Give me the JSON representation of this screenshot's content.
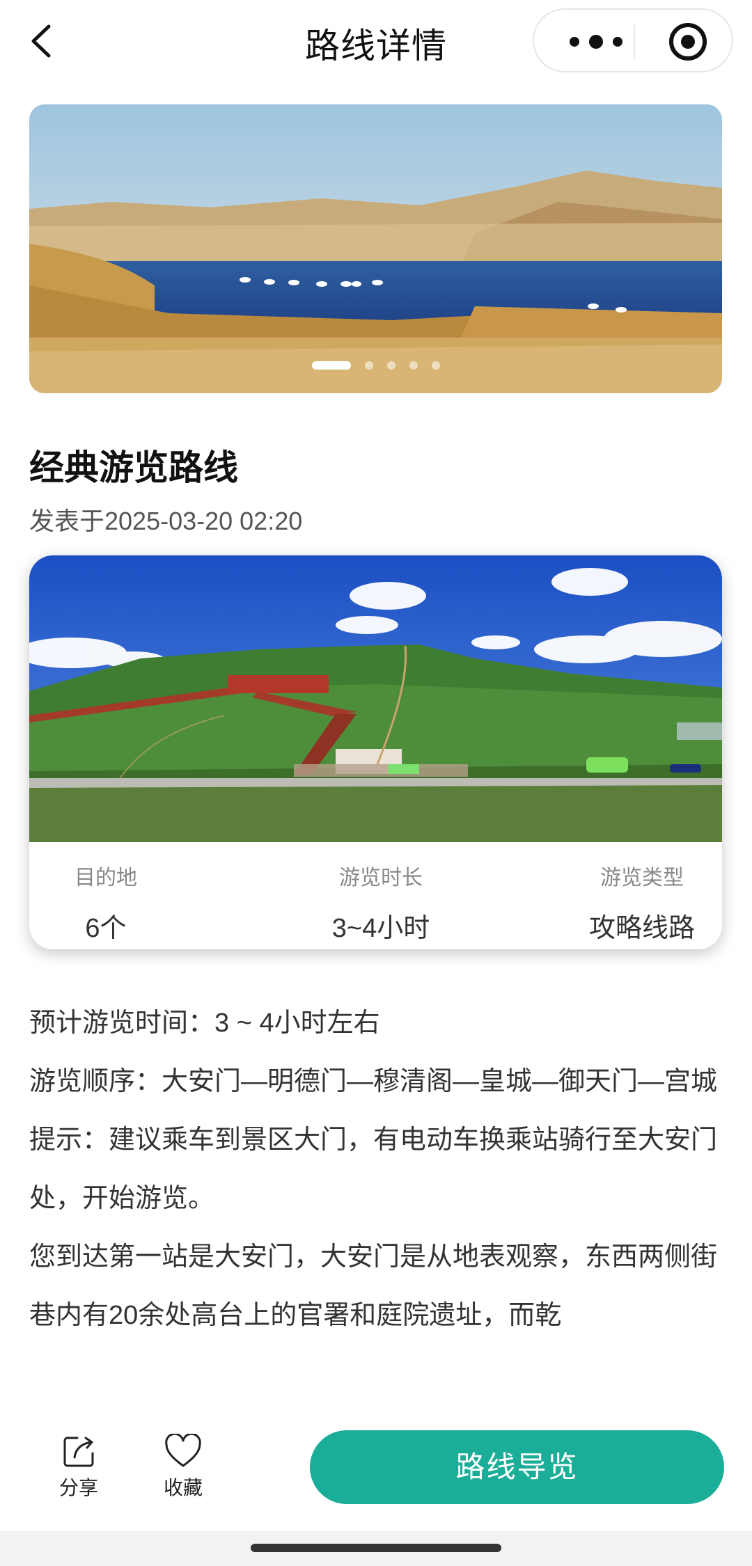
{
  "header": {
    "title": "路线详情",
    "icons": {
      "back": "chevron-left-icon",
      "more": "more-dots-icon",
      "close": "target-icon"
    }
  },
  "banner": {
    "slide_count": 5,
    "active_slide": 1
  },
  "route": {
    "title": "经典游览路线",
    "published": "发表于2025-03-20 02:20"
  },
  "stats": [
    {
      "label": "目的地",
      "value": "6个"
    },
    {
      "label": "游览时长",
      "value": "3~4小时"
    },
    {
      "label": "游览类型",
      "value": "攻略线路"
    }
  ],
  "description": {
    "p1": "预计游览时间：3 ~ 4小时左右",
    "p2": "游览顺序：大安门—明德门—穆清阁—皇城—御天门—宫城",
    "p3": "提示：建议乘车到景区大门，有电动车换乘站骑行至大安门处，开始游览。",
    "p4": "您到达第一站是大安门，大安门是从地表观察，东西两侧街巷内有20余处高台上的官署和庭院遗址，而乾"
  },
  "bottom_bar": {
    "share_label": "分享",
    "favorite_label": "收藏",
    "guide_label": "路线导览"
  },
  "colors": {
    "accent": "#1aad98"
  }
}
